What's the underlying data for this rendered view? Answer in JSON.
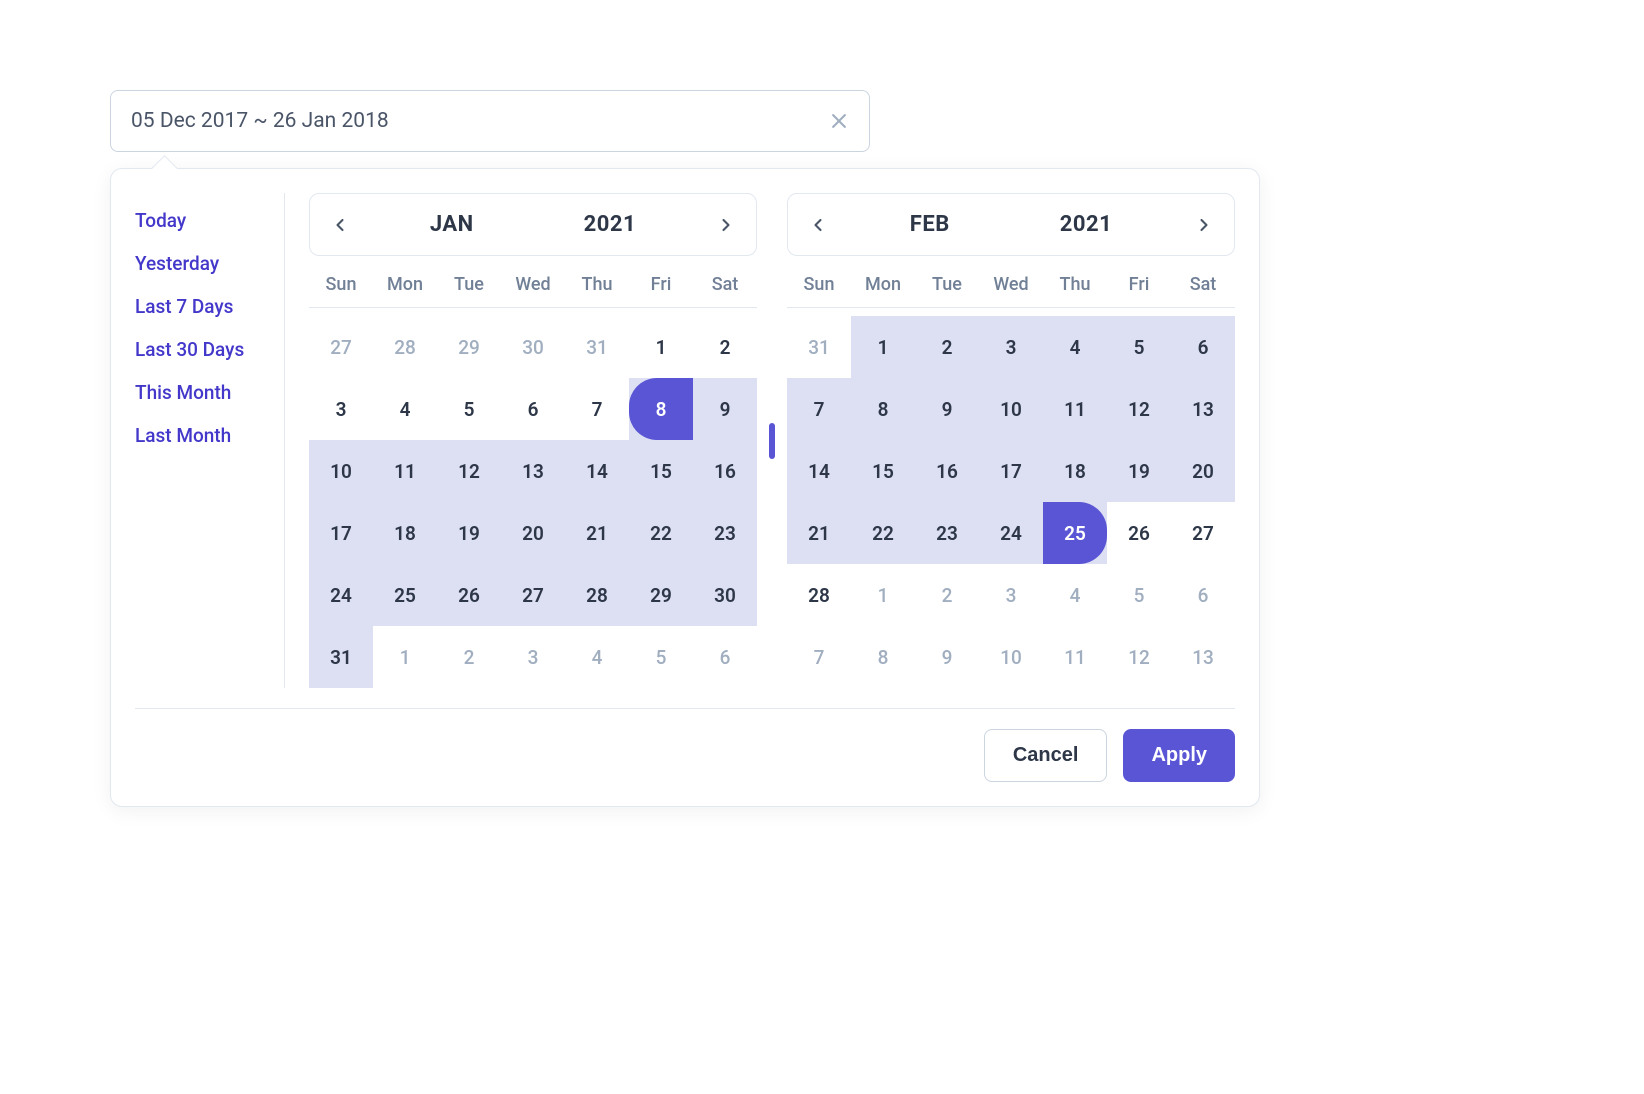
{
  "input": {
    "value": "05 Dec 2017 ~ 26 Jan 2018"
  },
  "presets": [
    {
      "label": "Today"
    },
    {
      "label": "Yesterday"
    },
    {
      "label": "Last 7 Days"
    },
    {
      "label": "Last 30 Days"
    },
    {
      "label": "This Month"
    },
    {
      "label": "Last Month"
    }
  ],
  "weekdays": [
    "Sun",
    "Mon",
    "Tue",
    "Wed",
    "Thu",
    "Fri",
    "Sat"
  ],
  "calendars": [
    {
      "month": "JAN",
      "year": "2021",
      "days": [
        {
          "n": "27",
          "otherMonth": true
        },
        {
          "n": "28",
          "otherMonth": true
        },
        {
          "n": "29",
          "otherMonth": true
        },
        {
          "n": "30",
          "otherMonth": true
        },
        {
          "n": "31",
          "otherMonth": true
        },
        {
          "n": "1"
        },
        {
          "n": "2"
        },
        {
          "n": "3"
        },
        {
          "n": "4"
        },
        {
          "n": "5"
        },
        {
          "n": "6"
        },
        {
          "n": "7"
        },
        {
          "n": "8",
          "rangeStart": true
        },
        {
          "n": "9",
          "inRange": true
        },
        {
          "n": "10",
          "inRange": true
        },
        {
          "n": "11",
          "inRange": true
        },
        {
          "n": "12",
          "inRange": true
        },
        {
          "n": "13",
          "inRange": true
        },
        {
          "n": "14",
          "inRange": true
        },
        {
          "n": "15",
          "inRange": true
        },
        {
          "n": "16",
          "inRange": true
        },
        {
          "n": "17",
          "inRange": true
        },
        {
          "n": "18",
          "inRange": true
        },
        {
          "n": "19",
          "inRange": true
        },
        {
          "n": "20",
          "inRange": true
        },
        {
          "n": "21",
          "inRange": true
        },
        {
          "n": "22",
          "inRange": true
        },
        {
          "n": "23",
          "inRange": true
        },
        {
          "n": "24",
          "inRange": true
        },
        {
          "n": "25",
          "inRange": true
        },
        {
          "n": "26",
          "inRange": true
        },
        {
          "n": "27",
          "inRange": true
        },
        {
          "n": "28",
          "inRange": true
        },
        {
          "n": "29",
          "inRange": true
        },
        {
          "n": "30",
          "inRange": true
        },
        {
          "n": "31",
          "inRange": true
        },
        {
          "n": "1",
          "otherMonth": true
        },
        {
          "n": "2",
          "otherMonth": true
        },
        {
          "n": "3",
          "otherMonth": true
        },
        {
          "n": "4",
          "otherMonth": true
        },
        {
          "n": "5",
          "otherMonth": true
        },
        {
          "n": "6",
          "otherMonth": true
        }
      ]
    },
    {
      "month": "FEB",
      "year": "2021",
      "days": [
        {
          "n": "31",
          "otherMonth": true
        },
        {
          "n": "1",
          "inRange": true
        },
        {
          "n": "2",
          "inRange": true
        },
        {
          "n": "3",
          "inRange": true
        },
        {
          "n": "4",
          "inRange": true
        },
        {
          "n": "5",
          "inRange": true
        },
        {
          "n": "6",
          "inRange": true
        },
        {
          "n": "7",
          "inRange": true
        },
        {
          "n": "8",
          "inRange": true
        },
        {
          "n": "9",
          "inRange": true
        },
        {
          "n": "10",
          "inRange": true
        },
        {
          "n": "11",
          "inRange": true
        },
        {
          "n": "12",
          "inRange": true
        },
        {
          "n": "13",
          "inRange": true
        },
        {
          "n": "14",
          "inRange": true
        },
        {
          "n": "15",
          "inRange": true
        },
        {
          "n": "16",
          "inRange": true
        },
        {
          "n": "17",
          "inRange": true
        },
        {
          "n": "18",
          "inRange": true
        },
        {
          "n": "19",
          "inRange": true
        },
        {
          "n": "20",
          "inRange": true
        },
        {
          "n": "21",
          "inRange": true
        },
        {
          "n": "22",
          "inRange": true
        },
        {
          "n": "23",
          "inRange": true
        },
        {
          "n": "24",
          "inRange": true
        },
        {
          "n": "25",
          "rangeEnd": true
        },
        {
          "n": "26"
        },
        {
          "n": "27"
        },
        {
          "n": "28"
        },
        {
          "n": "1",
          "otherMonth": true
        },
        {
          "n": "2",
          "otherMonth": true
        },
        {
          "n": "3",
          "otherMonth": true
        },
        {
          "n": "4",
          "otherMonth": true
        },
        {
          "n": "5",
          "otherMonth": true
        },
        {
          "n": "6",
          "otherMonth": true
        },
        {
          "n": "7",
          "otherMonth": true
        },
        {
          "n": "8",
          "otherMonth": true
        },
        {
          "n": "9",
          "otherMonth": true
        },
        {
          "n": "10",
          "otherMonth": true
        },
        {
          "n": "11",
          "otherMonth": true
        },
        {
          "n": "12",
          "otherMonth": true
        },
        {
          "n": "13",
          "otherMonth": true
        }
      ]
    }
  ],
  "footer": {
    "cancel": "Cancel",
    "apply": "Apply"
  }
}
